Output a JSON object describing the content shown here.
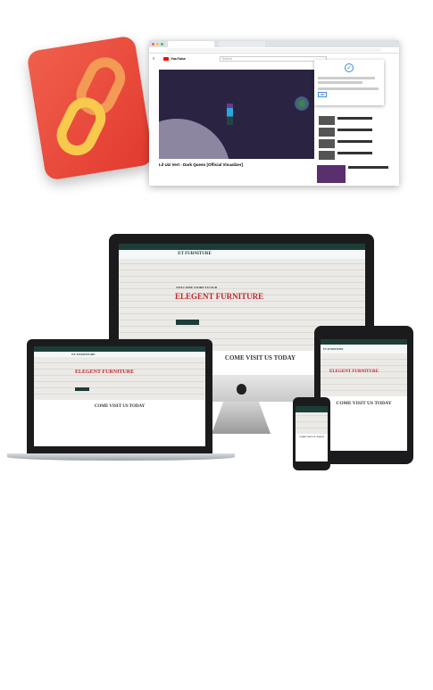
{
  "app_icon": {
    "icon": "chain-link-icon",
    "color": "#e8453a",
    "link_color": "#f5c84a"
  },
  "browser": {
    "youtube_logo": "YouTube",
    "search_placeholder": "Search",
    "popup_button": "OK",
    "video_title": "Lil Uzi Vert - Dark Queen [Official Visualizer]"
  },
  "website": {
    "logo": "ET FURNITURE",
    "welcome": "WELCOME STORE TO OUR",
    "headline": "ELEGENT FURNITURE",
    "section_title": "COME VISIT US TODAY",
    "accent": "#c0272d",
    "brand": "#1d3d38"
  }
}
